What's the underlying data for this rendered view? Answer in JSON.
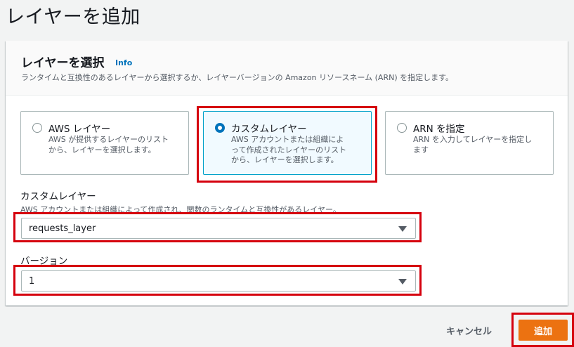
{
  "page": {
    "title": "レイヤーを追加"
  },
  "panel": {
    "heading": "レイヤーを選択",
    "info_link": "Info",
    "description": "ランタイムと互換性のあるレイヤーから選択するか、レイヤーバージョンの Amazon リソースネーム (ARN) を指定します。"
  },
  "layer_source": {
    "selected": "custom",
    "options": [
      {
        "id": "aws",
        "title": "AWS レイヤー",
        "desc_lines": [
          "AWS が提供するレイヤーのリスト",
          "から、レイヤーを選択します。"
        ]
      },
      {
        "id": "custom",
        "title": "カスタムレイヤー",
        "desc_lines": [
          "AWS アカウントまたは組織によ",
          "って作成されたレイヤーのリスト",
          "から、レイヤーを選択します。"
        ]
      },
      {
        "id": "arn",
        "title": "ARN を指定",
        "desc_lines": [
          "ARN を入力してレイヤーを指定し",
          "ます"
        ]
      }
    ]
  },
  "custom_layer": {
    "label": "カスタムレイヤー",
    "description": "AWS アカウントまたは組織によって作成され、関数のランタイムと互換性があるレイヤー。",
    "value": "requests_layer"
  },
  "version": {
    "label": "バージョン",
    "value": "1"
  },
  "footer": {
    "cancel_label": "キャンセル",
    "add_label": "追加"
  },
  "colors": {
    "primary": "#ec7211",
    "selected_border": "#00a1c9",
    "highlight": "#d5000d",
    "link": "#0073bb"
  }
}
